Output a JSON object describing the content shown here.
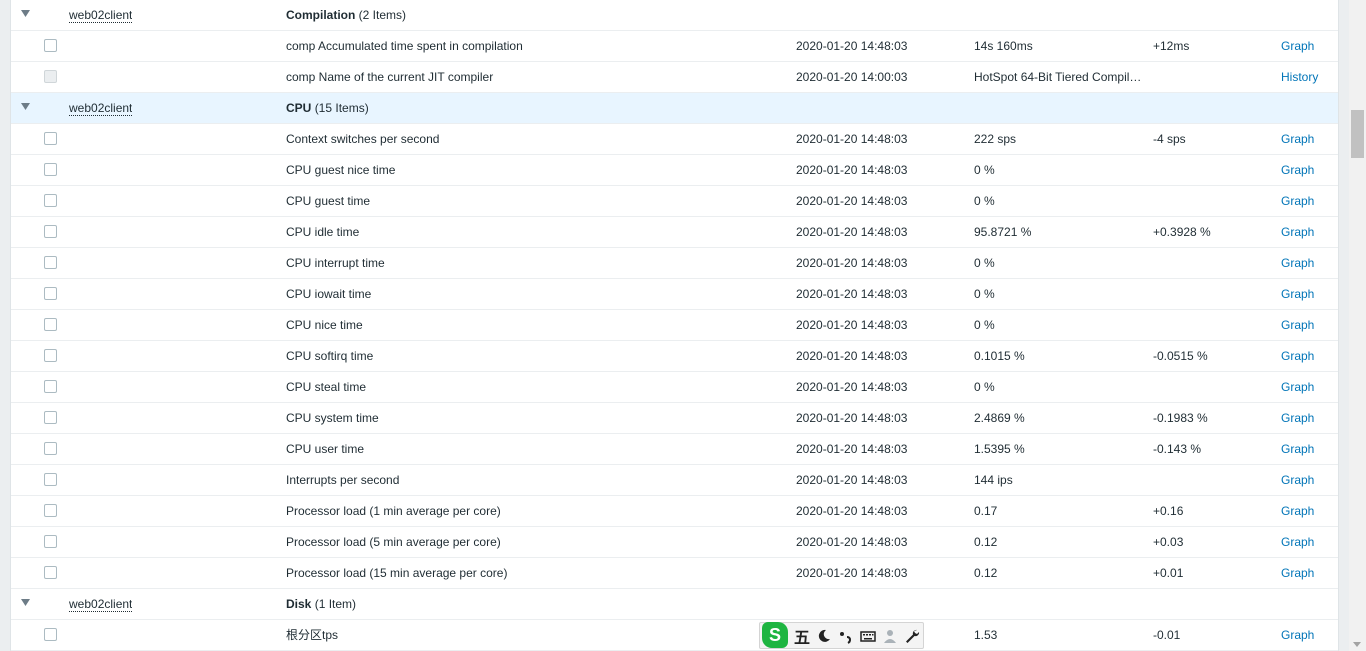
{
  "groups": [
    {
      "host": "web02client",
      "app_name": "Compilation",
      "count": "(2 Items)",
      "items": [
        {
          "name": "comp Accumulated time spent in compilation",
          "clock": "2020-01-20 14:48:03",
          "value": "14s 160ms",
          "change": "+12ms",
          "action": "Graph",
          "disabled": false
        },
        {
          "name": "comp Name of the current JIT compiler",
          "clock": "2020-01-20 14:00:03",
          "value": "HotSpot 64-Bit Tiered Compil…",
          "change": "",
          "action": "History",
          "disabled": true
        }
      ]
    },
    {
      "host": "web02client",
      "app_name": "CPU",
      "count": "(15 Items)",
      "highlight": true,
      "items": [
        {
          "name": "Context switches per second",
          "clock": "2020-01-20 14:48:03",
          "value": "222 sps",
          "change": "-4 sps",
          "action": "Graph"
        },
        {
          "name": "CPU guest nice time",
          "clock": "2020-01-20 14:48:03",
          "value": "0 %",
          "change": "",
          "action": "Graph"
        },
        {
          "name": "CPU guest time",
          "clock": "2020-01-20 14:48:03",
          "value": "0 %",
          "change": "",
          "action": "Graph"
        },
        {
          "name": "CPU idle time",
          "clock": "2020-01-20 14:48:03",
          "value": "95.8721 %",
          "change": "+0.3928 %",
          "action": "Graph"
        },
        {
          "name": "CPU interrupt time",
          "clock": "2020-01-20 14:48:03",
          "value": "0 %",
          "change": "",
          "action": "Graph"
        },
        {
          "name": "CPU iowait time",
          "clock": "2020-01-20 14:48:03",
          "value": "0 %",
          "change": "",
          "action": "Graph"
        },
        {
          "name": "CPU nice time",
          "clock": "2020-01-20 14:48:03",
          "value": "0 %",
          "change": "",
          "action": "Graph"
        },
        {
          "name": "CPU softirq time",
          "clock": "2020-01-20 14:48:03",
          "value": "0.1015 %",
          "change": "-0.0515 %",
          "action": "Graph"
        },
        {
          "name": "CPU steal time",
          "clock": "2020-01-20 14:48:03",
          "value": "0 %",
          "change": "",
          "action": "Graph"
        },
        {
          "name": "CPU system time",
          "clock": "2020-01-20 14:48:03",
          "value": "2.4869 %",
          "change": "-0.1983 %",
          "action": "Graph"
        },
        {
          "name": "CPU user time",
          "clock": "2020-01-20 14:48:03",
          "value": "1.5395 %",
          "change": "-0.143 %",
          "action": "Graph"
        },
        {
          "name": "Interrupts per second",
          "clock": "2020-01-20 14:48:03",
          "value": "144 ips",
          "change": "",
          "action": "Graph"
        },
        {
          "name": "Processor load (1 min average per core)",
          "clock": "2020-01-20 14:48:03",
          "value": "0.17",
          "change": "+0.16",
          "action": "Graph"
        },
        {
          "name": "Processor load (5 min average per core)",
          "clock": "2020-01-20 14:48:03",
          "value": "0.12",
          "change": "+0.03",
          "action": "Graph"
        },
        {
          "name": "Processor load (15 min average per core)",
          "clock": "2020-01-20 14:48:03",
          "value": "0.12",
          "change": "+0.01",
          "action": "Graph"
        }
      ]
    },
    {
      "host": "web02client",
      "app_name": "Disk",
      "count": "(1 Item)",
      "items": [
        {
          "name": "根分区tps",
          "clock": "",
          "value": "1.53",
          "change": "-0.01",
          "action": "Graph"
        }
      ]
    }
  ],
  "ime_toolbar": {
    "logo": "S",
    "mode": "五",
    "icons": [
      "moon-icon",
      "punctuation-icon",
      "keyboard-icon",
      "user-icon",
      "wrench-icon"
    ]
  },
  "colors": {
    "link": "#0275b8",
    "highlight_row": "#e8f5ff",
    "ime_logo": "#1eb541"
  }
}
